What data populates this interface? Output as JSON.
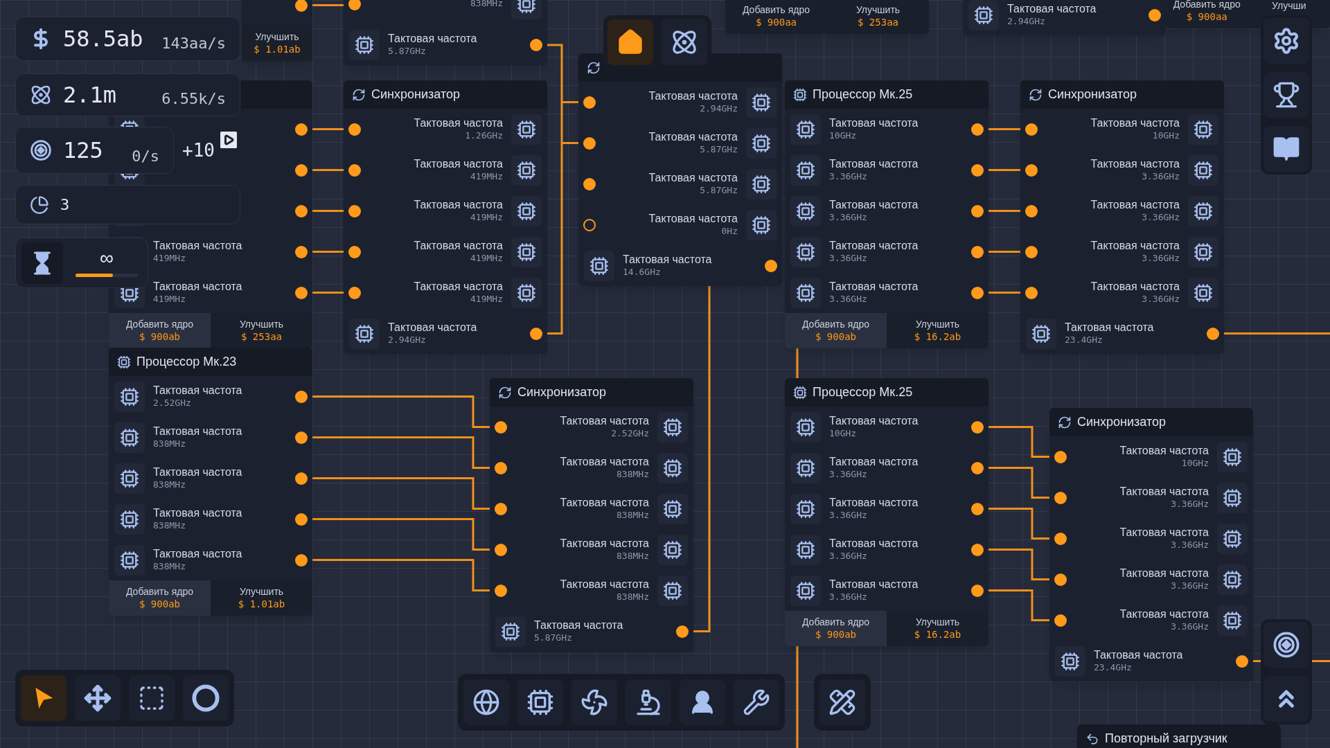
{
  "hud": {
    "stats": [
      {
        "kind": "money",
        "value": "58.5ab",
        "rate": "143aa/s"
      },
      {
        "kind": "atom",
        "value": "2.1m",
        "rate": "6.55k/s"
      },
      {
        "kind": "target",
        "value": "125",
        "rate": "0/s"
      },
      {
        "kind": "pie",
        "value": "3"
      }
    ],
    "bonus": {
      "label": "+10"
    },
    "timer": {
      "label": "∞",
      "level": 0.6
    }
  },
  "top_nav": [
    {
      "kind": "home",
      "selected": true
    },
    {
      "kind": "atom",
      "selected": false
    }
  ],
  "right_menu": [
    {
      "kind": "settings"
    },
    {
      "kind": "trophy"
    },
    {
      "kind": "book"
    }
  ],
  "right_bottom": [
    {
      "kind": "target"
    },
    {
      "kind": "upgrade"
    }
  ],
  "tools": [
    {
      "kind": "pointer",
      "selected": true
    },
    {
      "kind": "move",
      "selected": false
    },
    {
      "kind": "select",
      "selected": false
    },
    {
      "kind": "circle",
      "selected": false
    }
  ],
  "build_menu": [
    {
      "kind": "globe"
    },
    {
      "kind": "chip"
    },
    {
      "kind": "fan"
    },
    {
      "kind": "microscope"
    },
    {
      "kind": "hacker"
    },
    {
      "kind": "tools"
    },
    {
      "kind": "pencil-ruler"
    }
  ],
  "nodes": [
    {
      "cut": true,
      "rows": [
        {
          "kind": "output",
          "connected": true
        }
      ],
      "footer": {
        "upgrade": {
          "label": "Улучшить",
          "price": "$ 1.01ab"
        }
      }
    },
    {
      "cut": true,
      "rows": [
        {
          "kind": "input",
          "value": "838MHz",
          "connected": true
        },
        {
          "kind": "output",
          "label": "Тактовая частота",
          "value": "5.87GHz",
          "connected": true
        }
      ]
    },
    {
      "cut": true,
      "footer": {
        "add": {
          "label": "Добавить ядро",
          "price": "$ 900aa",
          "highlighted": false
        },
        "upgrade": {
          "label": "Улучшить",
          "price": "$ 253aa"
        }
      }
    },
    {
      "cut": true,
      "rows": [
        {
          "kind": "output",
          "label": "Тактовая частота",
          "value": "2.94GHz",
          "connected": true
        }
      ]
    },
    {
      "cut": true,
      "footer": {
        "add": {
          "label": "Добавить ядро",
          "price": "$ 900aa",
          "highlighted": false
        },
        "upgrade": {
          "label": "Улучши"
        }
      }
    },
    {
      "kind": "processor",
      "cut": false,
      "rows": [
        {
          "kind": "output",
          "connected": true
        },
        {
          "kind": "output",
          "connected": true
        },
        {
          "kind": "output",
          "connected": true
        },
        {
          "kind": "output",
          "label": "Тактовая частота",
          "value": "419MHz",
          "connected": true
        },
        {
          "kind": "output",
          "label": "Тактовая частота",
          "value": "419MHz",
          "connected": true
        }
      ],
      "footer": {
        "add": {
          "label": "Добавить ядро",
          "price": "$ 900ab",
          "highlighted": true
        },
        "upgrade": {
          "label": "Улучшить",
          "price": "$ 253aa"
        }
      }
    },
    {
      "kind": "synchronizer",
      "header": {
        "title": "Синхронизатор"
      },
      "rows": [
        {
          "kind": "input",
          "label": "Тактовая частота",
          "value": "1.26GHz",
          "connected": true
        },
        {
          "kind": "input",
          "label": "Тактовая частота",
          "value": "419MHz",
          "connected": true
        },
        {
          "kind": "input",
          "label": "Тактовая частота",
          "value": "419MHz",
          "connected": true
        },
        {
          "kind": "input",
          "label": "Тактовая частота",
          "value": "419MHz",
          "connected": true
        },
        {
          "kind": "input",
          "label": "Тактовая частота",
          "value": "419MHz",
          "connected": true
        },
        {
          "kind": "output",
          "label": "Тактовая частота",
          "value": "2.94GHz",
          "connected": true
        }
      ]
    },
    {
      "kind": "synchronizer",
      "cut": false,
      "rows": [
        {
          "kind": "input",
          "label": "Тактовая частота",
          "value": "2.94GHz",
          "connected": true
        },
        {
          "kind": "input",
          "label": "Тактовая частота",
          "value": "5.87GHz",
          "connected": true
        },
        {
          "kind": "input",
          "label": "Тактовая частота",
          "value": "5.87GHz",
          "connected": true
        },
        {
          "kind": "input",
          "label": "Тактовая частота",
          "value": "0Hz",
          "connected": false
        },
        {
          "kind": "output",
          "label": "Тактовая частота",
          "value": "14.6GHz",
          "connected": true
        }
      ]
    },
    {
      "kind": "processor",
      "header": {
        "title": "Процессор Мк.25"
      },
      "rows": [
        {
          "kind": "output",
          "label": "Тактовая частота",
          "value": "10GHz",
          "connected": true
        },
        {
          "kind": "output",
          "label": "Тактовая частота",
          "value": "3.36GHz",
          "connected": true
        },
        {
          "kind": "output",
          "label": "Тактовая частота",
          "value": "3.36GHz",
          "connected": true
        },
        {
          "kind": "output",
          "label": "Тактовая частота",
          "value": "3.36GHz",
          "connected": true
        },
        {
          "kind": "output",
          "label": "Тактовая частота",
          "value": "3.36GHz",
          "connected": true
        }
      ],
      "footer": {
        "add": {
          "label": "Добавить ядро",
          "price": "$ 900ab",
          "highlighted": true
        },
        "upgrade": {
          "label": "Улучшить",
          "price": "$ 16.2ab"
        }
      }
    },
    {
      "kind": "synchronizer",
      "header": {
        "title": "Синхронизатор"
      },
      "rows": [
        {
          "kind": "input",
          "label": "Тактовая частота",
          "value": "10GHz",
          "connected": true
        },
        {
          "kind": "input",
          "label": "Тактовая частота",
          "value": "3.36GHz",
          "connected": true
        },
        {
          "kind": "input",
          "label": "Тактовая частота",
          "value": "3.36GHz",
          "connected": true
        },
        {
          "kind": "input",
          "label": "Тактовая частота",
          "value": "3.36GHz",
          "connected": true
        },
        {
          "kind": "input",
          "label": "Тактовая частота",
          "value": "3.36GHz",
          "connected": true
        },
        {
          "kind": "output",
          "label": "Тактовая частота",
          "value": "23.4GHz",
          "connected": true
        }
      ]
    },
    {
      "kind": "processor",
      "header": {
        "title": "Процессор Мк.23"
      },
      "rows": [
        {
          "kind": "output",
          "label": "Тактовая частота",
          "value": "2.52GHz",
          "connected": true
        },
        {
          "kind": "output",
          "label": "Тактовая частота",
          "value": "838MHz",
          "connected": true
        },
        {
          "kind": "output",
          "label": "Тактовая частота",
          "value": "838MHz",
          "connected": true
        },
        {
          "kind": "output",
          "label": "Тактовая частота",
          "value": "838MHz",
          "connected": true
        },
        {
          "kind": "output",
          "label": "Тактовая частота",
          "value": "838MHz",
          "connected": true
        }
      ],
      "footer": {
        "add": {
          "label": "Добавить ядро",
          "price": "$ 900ab",
          "highlighted": true
        },
        "upgrade": {
          "label": "Улучшить",
          "price": "$ 1.01ab"
        }
      }
    },
    {
      "kind": "synchronizer",
      "header": {
        "title": "Синхронизатор"
      },
      "rows": [
        {
          "kind": "input",
          "label": "Тактовая частота",
          "value": "2.52GHz",
          "connected": true
        },
        {
          "kind": "input",
          "label": "Тактовая частота",
          "value": "838MHz",
          "connected": true
        },
        {
          "kind": "input",
          "label": "Тактовая частота",
          "value": "838MHz",
          "connected": true
        },
        {
          "kind": "input",
          "label": "Тактовая частота",
          "value": "838MHz",
          "connected": true
        },
        {
          "kind": "input",
          "label": "Тактовая частота",
          "value": "838MHz",
          "connected": true
        },
        {
          "kind": "output",
          "label": "Тактовая частота",
          "value": "5.87GHz",
          "connected": true
        }
      ]
    },
    {
      "kind": "processor",
      "header": {
        "title": "Процессор Мк.25"
      },
      "rows": [
        {
          "kind": "output",
          "label": "Тактовая частота",
          "value": "10GHz",
          "connected": true
        },
        {
          "kind": "output",
          "label": "Тактовая частота",
          "value": "3.36GHz",
          "connected": true
        },
        {
          "kind": "output",
          "label": "Тактовая частота",
          "value": "3.36GHz",
          "connected": true
        },
        {
          "kind": "output",
          "label": "Тактовая частота",
          "value": "3.36GHz",
          "connected": true
        },
        {
          "kind": "output",
          "label": "Тактовая частота",
          "value": "3.36GHz",
          "connected": true
        }
      ],
      "footer": {
        "add": {
          "label": "Добавить ядро",
          "price": "$ 900ab",
          "highlighted": true
        },
        "upgrade": {
          "label": "Улучшить",
          "price": "$ 16.2ab"
        }
      }
    },
    {
      "kind": "synchronizer",
      "header": {
        "title": "Синхронизатор"
      },
      "rows": [
        {
          "kind": "input",
          "label": "Тактовая частота",
          "value": "10GHz",
          "connected": true
        },
        {
          "kind": "input",
          "label": "Тактовая частота",
          "value": "3.36GHz",
          "connected": true
        },
        {
          "kind": "input",
          "label": "Тактовая частота",
          "value": "3.36GHz",
          "connected": true
        },
        {
          "kind": "input",
          "label": "Тактовая частота",
          "value": "3.36GHz",
          "connected": true
        },
        {
          "kind": "input",
          "label": "Тактовая частота",
          "value": "3.36GHz",
          "connected": true
        },
        {
          "kind": "output",
          "label": "Тактовая частота",
          "value": "23.4GHz",
          "connected": true
        }
      ]
    },
    {
      "kind": "loader",
      "header": {
        "title": "Повторный загрузчик"
      }
    }
  ]
}
